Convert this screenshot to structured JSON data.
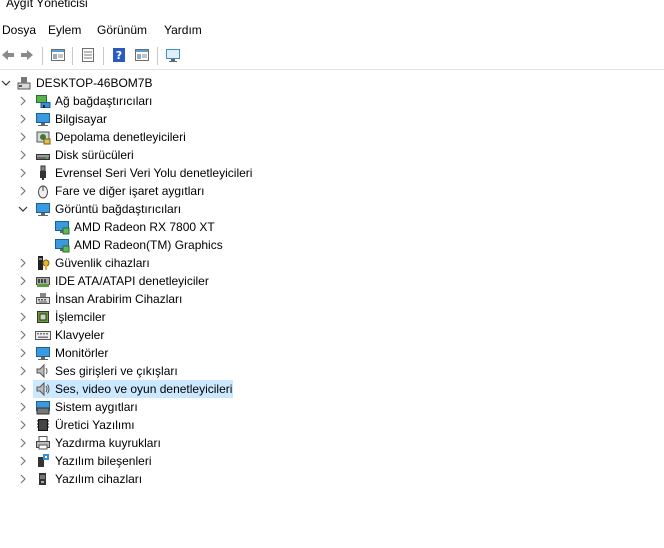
{
  "window": {
    "title": "Aygıt Yöneticisi"
  },
  "menu": [
    "Dosya",
    "Eylem",
    "Görünüm",
    "Yardım"
  ],
  "toolbar": {
    "buttons": [
      "back-arrow-icon",
      "forward-arrow-icon",
      "properties-icon",
      "list-view-icon",
      "help-icon",
      "window-icon",
      "monitor-icon"
    ]
  },
  "tree": {
    "root": "DESKTOP-46BOM7B",
    "items": [
      {
        "label": "Ağ bağdaştırıcıları",
        "icon": "network-icon",
        "expanded": false
      },
      {
        "label": "Bilgisayar",
        "icon": "computer-icon",
        "expanded": false
      },
      {
        "label": "Depolama denetleyicileri",
        "icon": "storage-icon",
        "expanded": false
      },
      {
        "label": "Disk sürücüleri",
        "icon": "disk-icon",
        "expanded": false
      },
      {
        "label": "Evrensel Seri Veri Yolu denetleyicileri",
        "icon": "usb-icon",
        "expanded": false
      },
      {
        "label": "Fare ve diğer işaret aygıtları",
        "icon": "mouse-icon",
        "expanded": false
      },
      {
        "label": "Görüntü bağdaştırıcıları",
        "icon": "display-adapter-icon",
        "expanded": true,
        "children": [
          {
            "label": "AMD  Radeon RX 7800 XT",
            "icon": "gpu-icon"
          },
          {
            "label": "AMD Radeon(TM) Graphics",
            "icon": "gpu-icon"
          }
        ]
      },
      {
        "label": "Güvenlik cihazları",
        "icon": "security-icon",
        "expanded": false
      },
      {
        "label": "IDE ATA/ATAPI denetleyiciler",
        "icon": "ide-icon",
        "expanded": false
      },
      {
        "label": "İnsan Arabirim Cihazları",
        "icon": "hid-icon",
        "expanded": false
      },
      {
        "label": "İşlemciler",
        "icon": "cpu-icon",
        "expanded": false
      },
      {
        "label": "Klavyeler",
        "icon": "keyboard-icon",
        "expanded": false
      },
      {
        "label": "Monitörler",
        "icon": "monitor-icon",
        "expanded": false
      },
      {
        "label": "Ses girişleri ve çıkışları",
        "icon": "speaker-icon",
        "expanded": false
      },
      {
        "label": "Ses, video ve oyun denetleyicileri",
        "icon": "sound-icon",
        "expanded": false,
        "selected": true
      },
      {
        "label": "Sistem aygıtları",
        "icon": "system-icon",
        "expanded": false
      },
      {
        "label": "Üretici Yazılımı",
        "icon": "firmware-icon",
        "expanded": false
      },
      {
        "label": "Yazdırma kuyrukları",
        "icon": "printer-icon",
        "expanded": false
      },
      {
        "label": "Yazılım bileşenleri",
        "icon": "software-component-icon",
        "expanded": false
      },
      {
        "label": "Yazılım cihazları",
        "icon": "software-device-icon",
        "expanded": false
      }
    ]
  },
  "colors": {
    "selection": "#cce8ff",
    "accent": "#1e8fd6"
  }
}
